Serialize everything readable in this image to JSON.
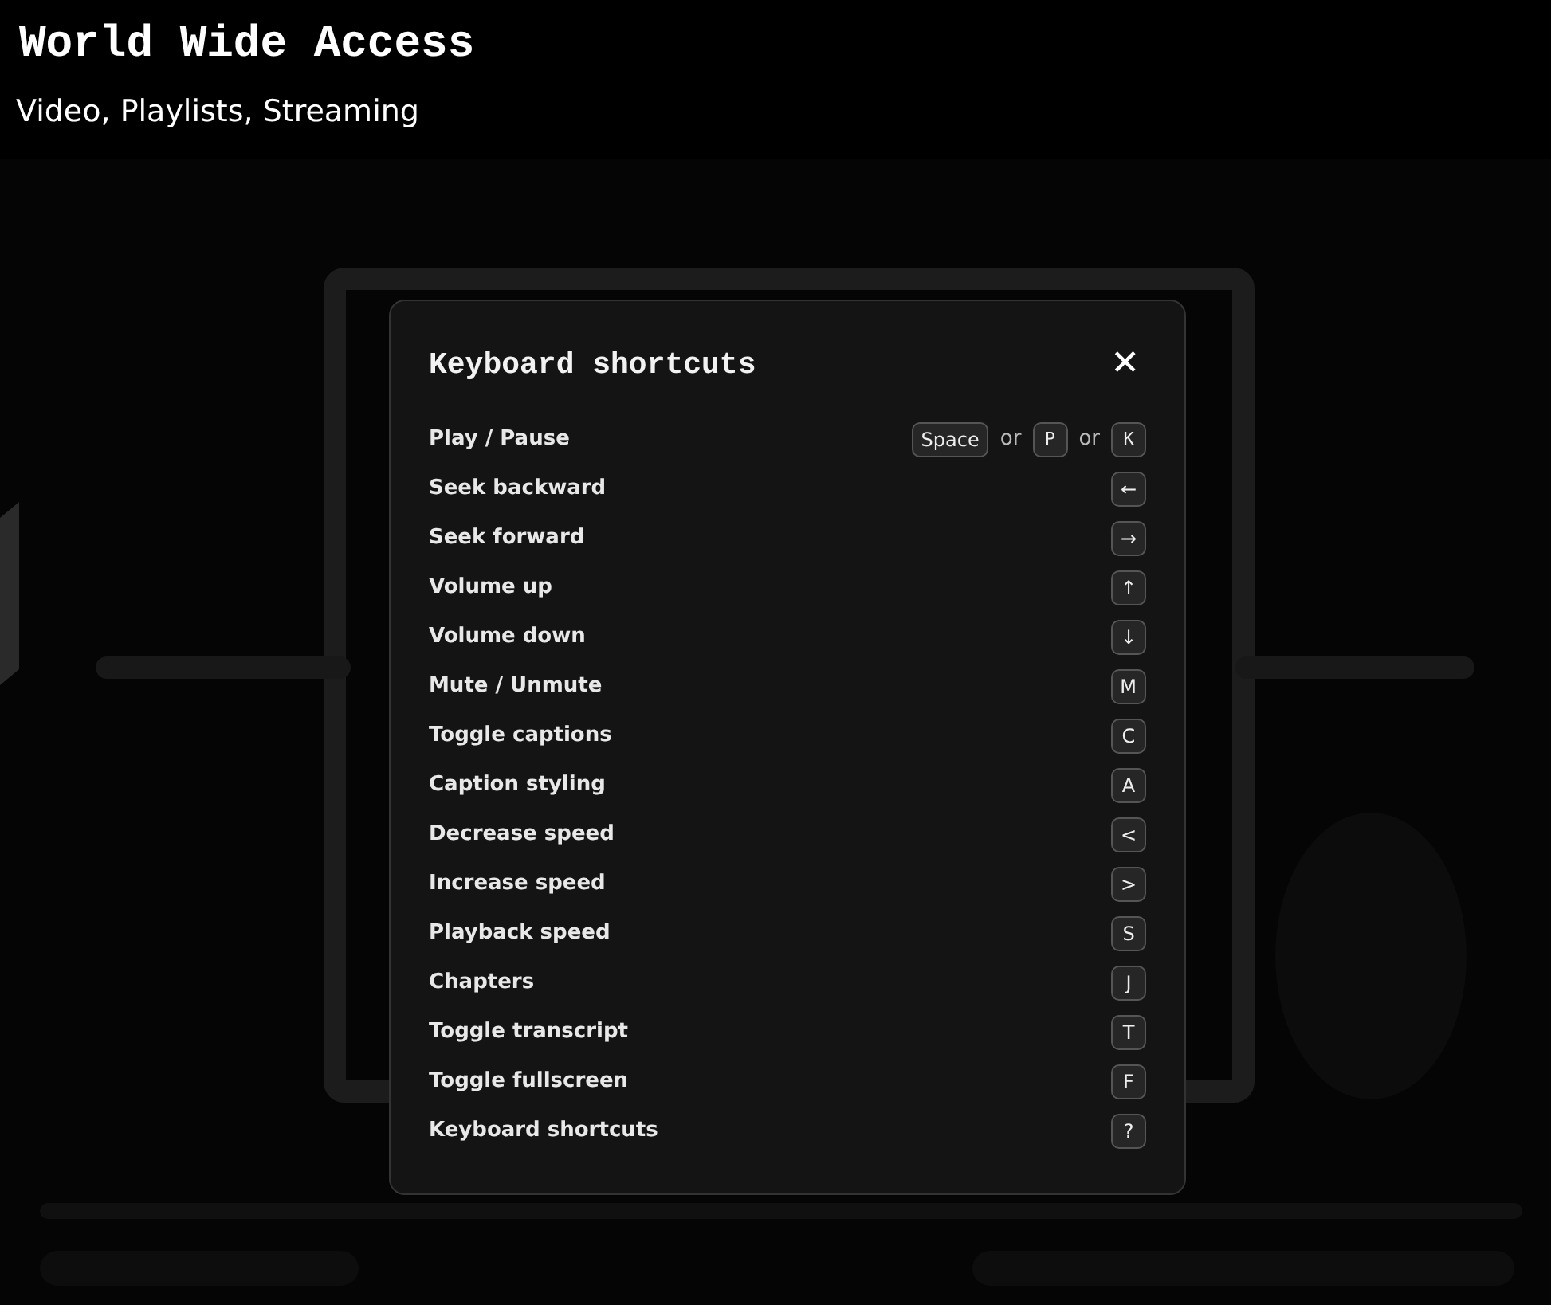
{
  "header": {
    "title": "World Wide Access",
    "subtitle": "Video, Playlists, Streaming"
  },
  "dialog": {
    "title": "Keyboard shortcuts",
    "close": "✕",
    "shortcuts": [
      {
        "action": "Play / Pause",
        "keys": [
          {
            "kind": "key",
            "label": "Space"
          },
          {
            "kind": "separator",
            "label": "or"
          },
          {
            "kind": "key",
            "label": "P"
          },
          {
            "kind": "separator",
            "label": "or"
          },
          {
            "kind": "key",
            "label": "K"
          }
        ]
      },
      {
        "action": "Seek backward",
        "keys": [
          {
            "kind": "key",
            "label": "←"
          }
        ]
      },
      {
        "action": "Seek forward",
        "keys": [
          {
            "kind": "key",
            "label": "→"
          }
        ]
      },
      {
        "action": "Volume up",
        "keys": [
          {
            "kind": "key",
            "label": "↑"
          }
        ]
      },
      {
        "action": "Volume down",
        "keys": [
          {
            "kind": "key",
            "label": "↓"
          }
        ]
      },
      {
        "action": "Mute / Unmute",
        "keys": [
          {
            "kind": "key",
            "label": "M"
          }
        ]
      },
      {
        "action": "Toggle captions",
        "keys": [
          {
            "kind": "key",
            "label": "C"
          }
        ]
      },
      {
        "action": "Caption styling",
        "keys": [
          {
            "kind": "key",
            "label": "A"
          }
        ]
      },
      {
        "action": "Decrease speed",
        "keys": [
          {
            "kind": "key",
            "label": "<"
          }
        ]
      },
      {
        "action": "Increase speed",
        "keys": [
          {
            "kind": "key",
            "label": ">"
          }
        ]
      },
      {
        "action": "Playback speed",
        "keys": [
          {
            "kind": "key",
            "label": "S"
          }
        ]
      },
      {
        "action": "Chapters",
        "keys": [
          {
            "kind": "key",
            "label": "J"
          }
        ]
      },
      {
        "action": "Toggle transcript",
        "keys": [
          {
            "kind": "key",
            "label": "T"
          }
        ]
      },
      {
        "action": "Toggle fullscreen",
        "keys": [
          {
            "kind": "key",
            "label": "F"
          }
        ]
      },
      {
        "action": "Keyboard shortcuts",
        "keys": [
          {
            "kind": "key",
            "label": "?"
          }
        ]
      }
    ]
  }
}
